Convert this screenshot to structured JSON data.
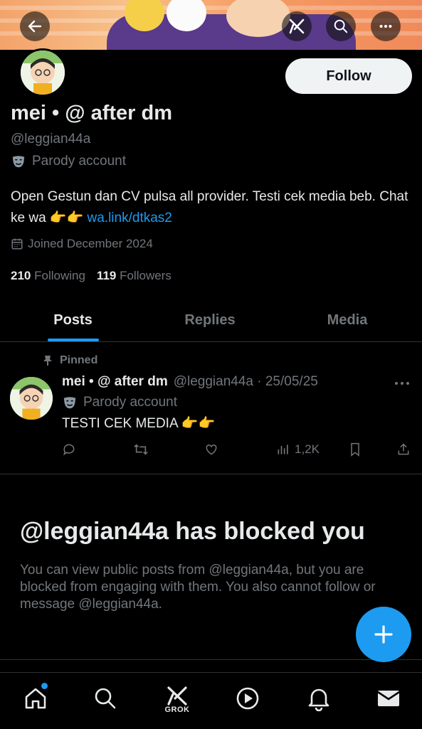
{
  "header": {
    "back_icon": "arrow-left-icon",
    "grok_icon": "grok-icon",
    "search_icon": "search-icon",
    "more_icon": "more-icon"
  },
  "profile": {
    "display_name": "mei • @ after dm",
    "handle": "@leggian44a",
    "badge_icon": "parody-mask-icon",
    "badge_label": "Parody account",
    "bio_text": "Open Gestun dan CV pulsa all provider. Testi cek media beb. Chat ke wa 👉👉 ",
    "bio_link": "wa.link/dtkas2",
    "joined": "Joined December 2024",
    "following_count": "210",
    "following_label": "Following",
    "followers_count": "119",
    "followers_label": "Followers",
    "follow_label": "Follow"
  },
  "tabs": [
    {
      "label": "Posts",
      "active": true
    },
    {
      "label": "Replies",
      "active": false
    },
    {
      "label": "Media",
      "active": false
    }
  ],
  "pinned_post": {
    "pinned_label": "Pinned",
    "name": "mei • @ after dm",
    "meta": "@leggian44a · 25/05/25",
    "badge_label": "Parody account",
    "text": "TESTI CEK MEDIA 👉👉",
    "views": "1,2K"
  },
  "blocked": {
    "title": "@leggian44a has blocked you",
    "message": "You can view public posts from @leggian44a, but you are blocked from engaging with them. You also cannot follow or message @leggian44a."
  },
  "bottom_nav": {
    "grok_label": "GROK"
  },
  "colors": {
    "accent": "#1d9bf0",
    "background": "#000000",
    "text_primary": "#e7e9ea",
    "text_secondary": "#71767b"
  }
}
